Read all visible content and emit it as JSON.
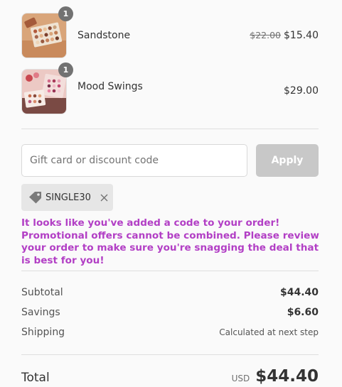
{
  "items": [
    {
      "name": "Sandstone",
      "quantity": "1",
      "original_price": "$22.00",
      "price": "$15.40"
    },
    {
      "name": "Mood Swings",
      "quantity": "1",
      "original_price": "",
      "price": "$29.00"
    }
  ],
  "discount": {
    "placeholder": "Gift card or discount code",
    "value": "",
    "apply_label": "Apply",
    "applied_code": "SINGLE30",
    "message": "It looks like you've added a code to your order! Promotional offers cannot be combined. Please review your order to make sure you're snagging the deal that is best for you!"
  },
  "summary": {
    "subtotal_label": "Subtotal",
    "subtotal_value": "$44.40",
    "savings_label": "Savings",
    "savings_value": "$6.60",
    "shipping_label": "Shipping",
    "shipping_value": "Calculated at next step",
    "total_label": "Total",
    "total_currency": "USD",
    "total_value": "$44.40"
  },
  "colors": {
    "promo_message": "#b23fc5",
    "apply_button_disabled": "#c8c8c8",
    "quantity_badge": "#727272"
  }
}
